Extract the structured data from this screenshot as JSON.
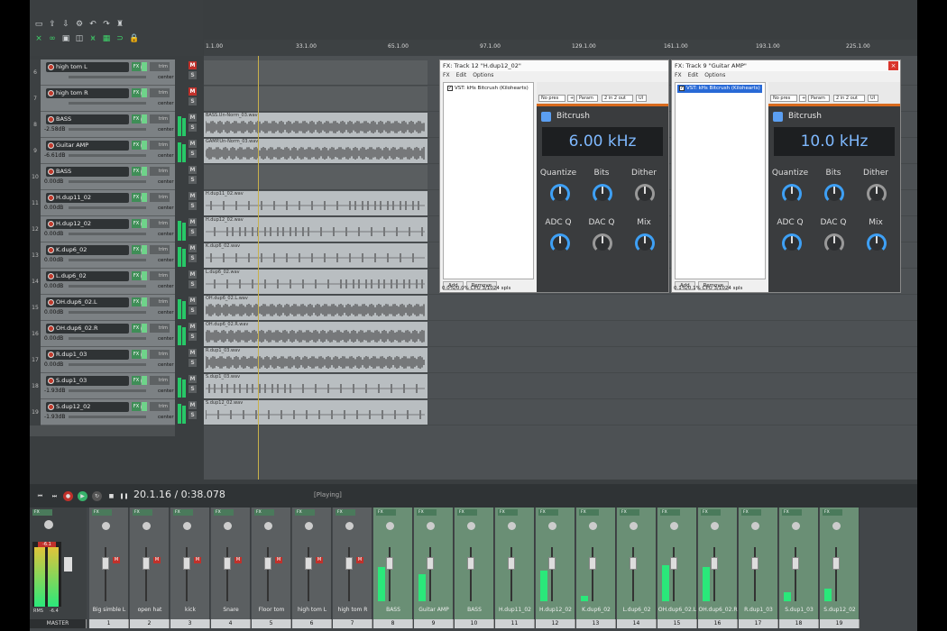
{
  "ruler": {
    "ticks": [
      "1.1.00",
      "33.1.00",
      "65.1.00",
      "97.1.00",
      "129.1.00",
      "161.1.00",
      "193.1.00",
      "225.1.00"
    ]
  },
  "tracks": [
    {
      "num": "6",
      "name": "high tom L",
      "vol": "",
      "muted": true
    },
    {
      "num": "7",
      "name": "high tom R",
      "vol": "",
      "muted": true
    },
    {
      "num": "8",
      "name": "BASS",
      "vol": "-2.58dB",
      "muted": false
    },
    {
      "num": "9",
      "name": "Guitar AMP",
      "vol": "-6.61dB",
      "muted": false
    },
    {
      "num": "10",
      "name": "BASS",
      "vol": "0.00dB",
      "muted": false
    },
    {
      "num": "11",
      "name": "H.dup11_02",
      "vol": "0.00dB",
      "muted": false
    },
    {
      "num": "12",
      "name": "H.dup12_02",
      "vol": "0.00dB",
      "muted": false
    },
    {
      "num": "13",
      "name": "K.dup6_02",
      "vol": "0.00dB",
      "muted": false
    },
    {
      "num": "14",
      "name": "L.dup6_02",
      "vol": "0.00dB",
      "muted": false
    },
    {
      "num": "15",
      "name": "OH.dup6_02.L",
      "vol": "0.00dB",
      "muted": false
    },
    {
      "num": "16",
      "name": "OH.dup6_02.R",
      "vol": "0.00dB",
      "muted": false
    },
    {
      "num": "17",
      "name": "R.dup1_03",
      "vol": "0.00dB",
      "muted": false
    },
    {
      "num": "18",
      "name": "S.dup1_03",
      "vol": "-1.93dB",
      "muted": false
    },
    {
      "num": "19",
      "name": "S.dup12_02",
      "vol": "-1.93dB",
      "muted": false
    }
  ],
  "tcp_labels": {
    "fx": "FX",
    "trim": "trim",
    "pan": "center",
    "mute": "M",
    "solo": "S"
  },
  "items": [
    "",
    "",
    "BASS.Un-Norm_03.wav",
    "GAMP.Un-Norm_03.wav",
    "",
    "H.dup11_02.wav",
    "H.dup12_02.wav",
    "K.dup6_02.wav",
    "L.dup6_02.wav",
    "OH.dup6_02.L.wav",
    "OH.dup6_02.R.wav",
    "R.dup1_03.wav",
    "S.dup1_03.wav",
    "S.dup12_02.wav"
  ],
  "fx1": {
    "title": "FX: Track 12 \"H.dup12_02\"",
    "menu": [
      "FX",
      "Edit",
      "Options"
    ],
    "item": "VST: kHs Bitcrush (Kilohearts)",
    "preset": "No pres",
    "param": "Param",
    "io": "2 in 2 out",
    "ui": "UI",
    "add": "Add",
    "remove": "Remove",
    "status": "0.0%/0.0% CPU 3/1024 spls",
    "plugin_title": "Bitcrush",
    "freq": "6.00 kHz",
    "labels": [
      "Quantize",
      "Bits",
      "Dither",
      "ADC Q",
      "DAC Q",
      "Mix"
    ]
  },
  "fx2": {
    "title": "FX: Track 9 \"Guitar AMP\"",
    "menu": [
      "FX",
      "Edit",
      "Options"
    ],
    "item": "VST: kHs Bitcrush (Kilohearts)",
    "preset": "No pres",
    "param": "Param",
    "io": "2 in 2 out",
    "ui": "UI",
    "add": "Add",
    "remove": "Remove",
    "status": "0.1%/0.1% CPU 3/1024 spls",
    "plugin_title": "Bitcrush",
    "freq": "10.0 kHz",
    "labels": [
      "Quantize",
      "Bits",
      "Dither",
      "ADC Q",
      "DAC Q",
      "Mix"
    ]
  },
  "transport": {
    "time": "20.1.16 / 0:38.078",
    "status": "[Playing]"
  },
  "mixer": {
    "master_label": "MASTER",
    "master_vol": "-6.1",
    "master_rms": "RMS",
    "master_val": "-6.4",
    "strips": [
      {
        "name": "Big simble L",
        "num": "1"
      },
      {
        "name": "open hat",
        "num": "2"
      },
      {
        "name": "kick",
        "num": "3"
      },
      {
        "name": "Snare",
        "num": "4"
      },
      {
        "name": "Floor tom",
        "num": "5"
      },
      {
        "name": "high tom L",
        "num": "6"
      },
      {
        "name": "high tom R",
        "num": "7"
      },
      {
        "name": "BASS",
        "num": "8"
      },
      {
        "name": "Guitar AMP",
        "num": "9"
      },
      {
        "name": "BASS",
        "num": "10"
      },
      {
        "name": "H.dup11_02",
        "num": "11"
      },
      {
        "name": "H.dup12_02",
        "num": "12"
      },
      {
        "name": "K.dup6_02",
        "num": "13"
      },
      {
        "name": "L.dup6_02",
        "num": "14"
      },
      {
        "name": "OH.dup6_02.L",
        "num": "15"
      },
      {
        "name": "OH.dup6_02.R",
        "num": "16"
      },
      {
        "name": "R.dup1_03",
        "num": "17"
      },
      {
        "name": "S.dup1_03",
        "num": "18"
      },
      {
        "name": "S.dup12_02",
        "num": "19"
      }
    ]
  }
}
